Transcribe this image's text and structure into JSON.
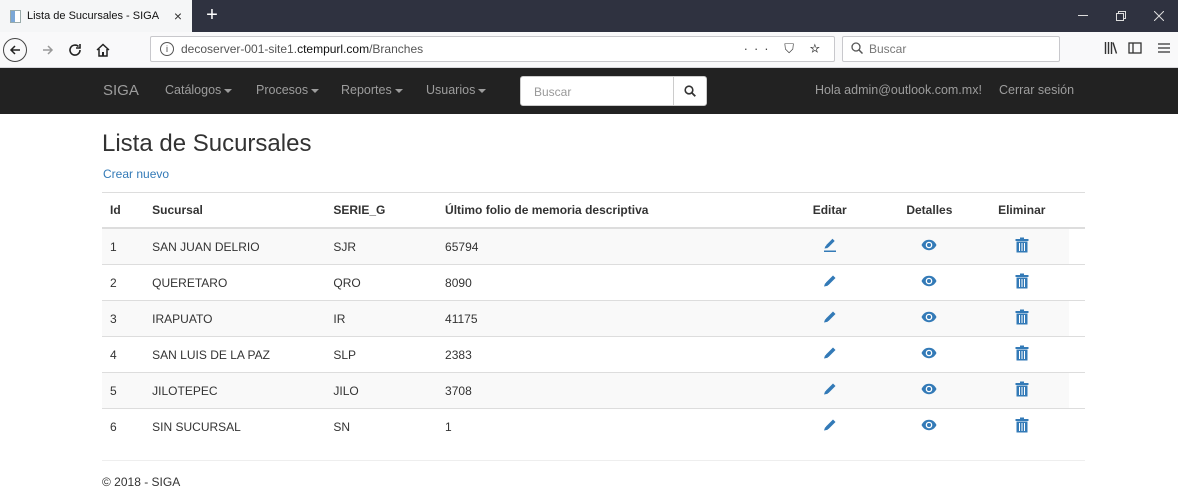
{
  "browser": {
    "tab_title": "Lista de Sucursales - SIGA",
    "tab_close": "×",
    "new_tab": "+",
    "url_prefix": "decoserver-001-site1.",
    "url_domain": "ctempurl.com",
    "url_path": "/Branches",
    "search_placeholder": "Buscar",
    "page_actions": "··· ⛉ ☆"
  },
  "navbar": {
    "brand": "SIGA",
    "menus": [
      "Catálogos",
      "Procesos",
      "Reportes",
      "Usuarios"
    ],
    "search_placeholder": "Buscar",
    "greeting": "Hola admin@outlook.com.mx!",
    "logout": "Cerrar sesión"
  },
  "page": {
    "title": "Lista de Sucursales",
    "create_link": "Crear nuevo"
  },
  "table": {
    "headers": {
      "id": "Id",
      "branch": "Sucursal",
      "series": "SERIE_G",
      "folio": "Último folio de memoria descriptiva",
      "edit": "Editar",
      "details": "Detalles",
      "delete": "Eliminar"
    },
    "rows": [
      {
        "id": "1",
        "branch": "SAN JUAN DELRIO",
        "series": "SJR",
        "folio": "65794"
      },
      {
        "id": "2",
        "branch": "QUERETARO",
        "series": "QRO",
        "folio": "8090"
      },
      {
        "id": "3",
        "branch": "IRAPUATO",
        "series": "IR",
        "folio": "41175"
      },
      {
        "id": "4",
        "branch": "SAN LUIS DE LA PAZ",
        "series": "SLP",
        "folio": "2383"
      },
      {
        "id": "5",
        "branch": "JILOTEPEC",
        "series": "JILO",
        "folio": "3708"
      },
      {
        "id": "6",
        "branch": "SIN SUCURSAL",
        "series": "SN",
        "folio": "1"
      }
    ]
  },
  "footer": {
    "text": "© 2018 - SIGA"
  },
  "colors": {
    "accent": "#337ab7",
    "navbar_bg": "#222222",
    "tabstrip_bg": "#2f3240"
  },
  "icons": {
    "edit": "pencil-icon",
    "details": "eye-icon",
    "delete": "trash-icon"
  }
}
